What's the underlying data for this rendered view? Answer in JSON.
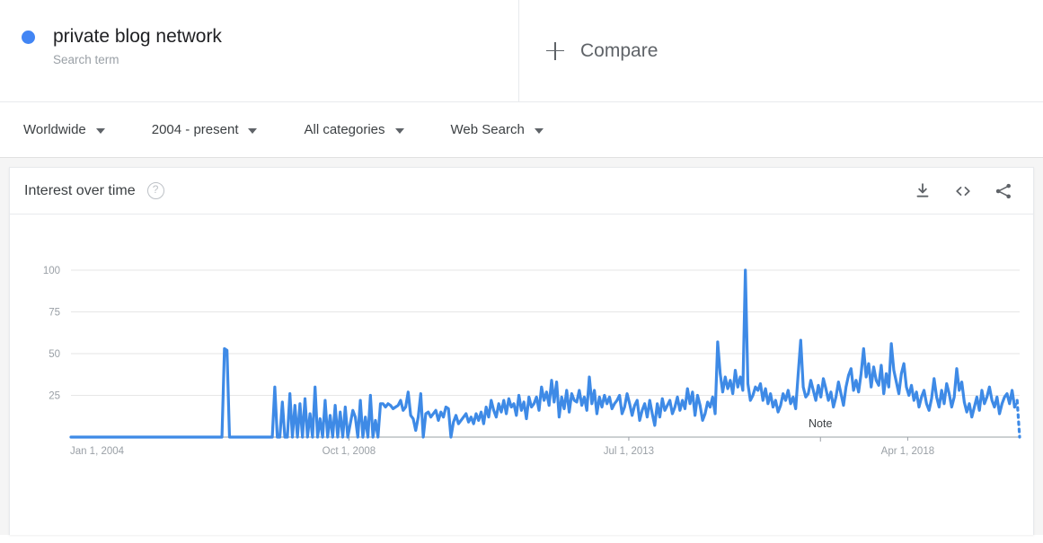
{
  "term": {
    "title": "private blog network",
    "subtitle": "Search term",
    "dot_color": "#4285f4"
  },
  "compare": {
    "label": "Compare",
    "icon": "plus-icon"
  },
  "filters": [
    {
      "label": "Worldwide",
      "icon": "chevron-down-icon"
    },
    {
      "label": "2004 - present",
      "icon": "chevron-down-icon"
    },
    {
      "label": "All categories",
      "icon": "chevron-down-icon"
    },
    {
      "label": "Web Search",
      "icon": "chevron-down-icon"
    }
  ],
  "card": {
    "title": "Interest over time",
    "help_icon": "help-circle-icon",
    "help_glyph": "?",
    "actions": [
      {
        "name": "download-icon"
      },
      {
        "name": "embed-code-icon"
      },
      {
        "name": "share-icon"
      }
    ]
  },
  "chart_data": {
    "type": "line",
    "title": "Interest over time",
    "xlabel": "",
    "ylabel": "",
    "ylim": [
      0,
      100
    ],
    "yticks": [
      25,
      50,
      75,
      100
    ],
    "grid": true,
    "legend": false,
    "line_color": "#3e8ae6",
    "annotations": [
      {
        "text": "Note",
        "x_fraction": 0.79
      }
    ],
    "x_tick_labels": [
      "Jan 1, 2004",
      "Oct 1, 2008",
      "Jul 1, 2013",
      "Apr 1, 2018"
    ],
    "x_tick_fractions": [
      0.0,
      0.293,
      0.588,
      0.882
    ],
    "partial_tail": true,
    "series": [
      {
        "name": "private blog network",
        "values": [
          0,
          0,
          0,
          0,
          0,
          0,
          0,
          0,
          0,
          0,
          0,
          0,
          0,
          0,
          0,
          0,
          0,
          0,
          0,
          0,
          0,
          0,
          0,
          0,
          0,
          0,
          0,
          0,
          0,
          0,
          0,
          0,
          0,
          0,
          0,
          0,
          0,
          0,
          0,
          0,
          0,
          0,
          0,
          0,
          0,
          0,
          0,
          0,
          0,
          0,
          0,
          0,
          0,
          0,
          0,
          0,
          0,
          0,
          0,
          0,
          0,
          53,
          52,
          0,
          0,
          0,
          0,
          0,
          0,
          0,
          0,
          0,
          0,
          0,
          0,
          0,
          0,
          0,
          0,
          0,
          0,
          30,
          0,
          0,
          21,
          0,
          0,
          26,
          0,
          19,
          0,
          20,
          0,
          23,
          0,
          14,
          0,
          30,
          0,
          11,
          0,
          22,
          0,
          13,
          0,
          19,
          0,
          15,
          0,
          18,
          0,
          8,
          16,
          12,
          0,
          22,
          0,
          12,
          0,
          25,
          0,
          10,
          0,
          20,
          20,
          18,
          20,
          19,
          17,
          18,
          19,
          22,
          16,
          18,
          27,
          13,
          11,
          4,
          12,
          26,
          0,
          14,
          15,
          12,
          14,
          16,
          10,
          15,
          12,
          18,
          17,
          0,
          9,
          13,
          8,
          10,
          12,
          14,
          9,
          12,
          8,
          14,
          10,
          15,
          8,
          18,
          12,
          22,
          16,
          12,
          20,
          15,
          22,
          14,
          23,
          18,
          20,
          13,
          25,
          16,
          21,
          11,
          24,
          18,
          20,
          24,
          16,
          30,
          22,
          27,
          19,
          34,
          21,
          33,
          12,
          24,
          17,
          28,
          15,
          26,
          22,
          21,
          28,
          19,
          24,
          16,
          36,
          20,
          28,
          14,
          24,
          18,
          25,
          20,
          24,
          17,
          20,
          22,
          25,
          14,
          18,
          26,
          20,
          13,
          19,
          22,
          10,
          16,
          20,
          12,
          22,
          14,
          7,
          20,
          12,
          23,
          16,
          19,
          22,
          14,
          18,
          24,
          16,
          22,
          17,
          29,
          20,
          27,
          13,
          25,
          19,
          10,
          14,
          21,
          18,
          24,
          14,
          57,
          38,
          27,
          36,
          29,
          34,
          26,
          40,
          30,
          36,
          28,
          100,
          32,
          22,
          25,
          30,
          28,
          32,
          22,
          29,
          20,
          26,
          18,
          22,
          15,
          19,
          26,
          22,
          28,
          20,
          24,
          17,
          38,
          58,
          30,
          24,
          26,
          34,
          28,
          22,
          31,
          24,
          35,
          29,
          22,
          27,
          18,
          24,
          33,
          26,
          19,
          30,
          37,
          41,
          28,
          34,
          27,
          38,
          53,
          36,
          44,
          30,
          42,
          34,
          31,
          43,
          26,
          38,
          30,
          56,
          40,
          33,
          26,
          38,
          44,
          30,
          25,
          31,
          22,
          27,
          18,
          24,
          28,
          20,
          16,
          23,
          35,
          24,
          18,
          28,
          20,
          32,
          26,
          18,
          24,
          41,
          28,
          33,
          21,
          15,
          20,
          12,
          18,
          24,
          16,
          28,
          20,
          24,
          30,
          22,
          18,
          24,
          14,
          20,
          24,
          26,
          20,
          28,
          18,
          22,
          0
        ]
      }
    ]
  }
}
